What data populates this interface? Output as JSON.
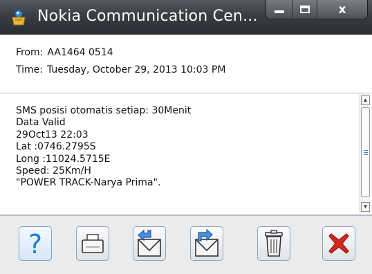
{
  "window": {
    "title": "Nokia Communication Cen...",
    "controls": {
      "minimize": "minimize-icon",
      "maximize": "maximize-icon",
      "close_label": "x"
    }
  },
  "header": {
    "from_label": "From:",
    "from_value": "AA1464 0514",
    "time_label": "Time:",
    "time_value": "Tuesday, October 29, 2013 10:03 PM"
  },
  "message": {
    "body": "SMS posisi otomatis setiap: 30Menit\nData Valid\n29Oct13 22:03\nLat :0746.2795S\nLong :11024.5715E\nSpeed: 25Km/H\n\"POWER TRACK-Narya Prima\"."
  },
  "toolbar": {
    "help_glyph": "?",
    "icons": [
      "help-icon",
      "print-icon",
      "reply-icon",
      "forward-icon",
      "delete-icon",
      "close-icon"
    ]
  },
  "colors": {
    "titlebar": "#3a3e44",
    "help_blue": "#1a7fd6",
    "close_red": "#d42a1e",
    "arrow_blue": "#4a8fd8"
  }
}
